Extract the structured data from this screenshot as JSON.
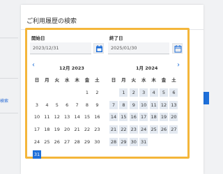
{
  "dialog": {
    "title": "ご利用履歴の検索"
  },
  "start": {
    "label": "開始日",
    "value": "2023/12/31",
    "icon": "calendar-icon"
  },
  "end": {
    "label": "終了日",
    "value": "2025/01/30",
    "icon": "calendar-icon"
  },
  "calendar": {
    "prev": "‹",
    "next": "›",
    "weekdays": [
      "日",
      "月",
      "火",
      "水",
      "木",
      "金",
      "土"
    ],
    "left": {
      "title": "12月 2023",
      "days": [
        "1",
        "2",
        "3",
        "4",
        "5",
        "6",
        "7",
        "8",
        "9",
        "10",
        "11",
        "12",
        "13",
        "14",
        "15",
        "16",
        "17",
        "18",
        "19",
        "20",
        "21",
        "22",
        "23",
        "24",
        "25",
        "26",
        "27",
        "28",
        "29",
        "30",
        "31"
      ],
      "first_weekday_index": 5,
      "selected_day": "31"
    },
    "right": {
      "title": "1月 2024",
      "days": [
        "1",
        "2",
        "3",
        "4",
        "5",
        "6",
        "7",
        "8",
        "9",
        "10",
        "11",
        "12",
        "13",
        "14",
        "15",
        "16",
        "17",
        "18",
        "19",
        "20",
        "21",
        "22",
        "23",
        "24",
        "25",
        "26",
        "27",
        "28",
        "29",
        "30",
        "31"
      ],
      "first_weekday_index": 1,
      "in_range": true
    }
  },
  "background": {
    "link_text": "検索",
    "accent": "#1e6fd9"
  },
  "colors": {
    "highlight": "#f4b63a",
    "range": "#e3e9f1",
    "selected": "#1e6fd9"
  }
}
